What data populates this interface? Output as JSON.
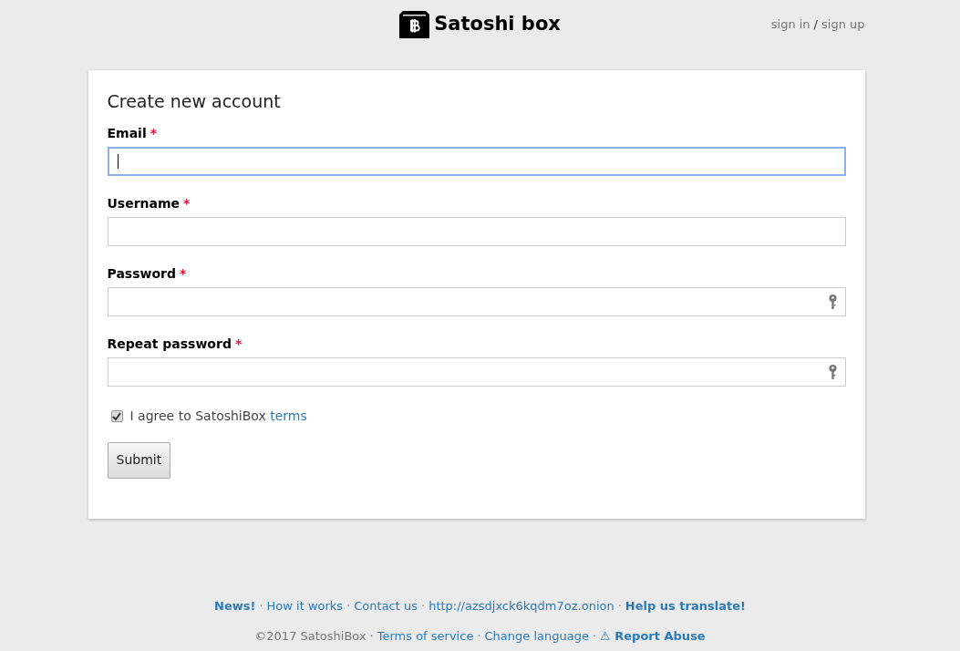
{
  "header": {
    "brand": "Satoshi box",
    "auth_links": [
      {
        "kind": "link",
        "text": "sign in"
      },
      {
        "kind": "text",
        "text": "/"
      },
      {
        "kind": "link",
        "text": "sign up"
      }
    ]
  },
  "form": {
    "title": "Create new account",
    "fields": [
      {
        "label": "Email",
        "required_mark": "*",
        "kind": "email",
        "focused": true
      },
      {
        "label": "Username",
        "required_mark": "*",
        "kind": "text",
        "focused": false
      },
      {
        "label": "Password",
        "required_mark": "*",
        "kind": "password",
        "focused": false
      },
      {
        "label": "Repeat password",
        "required_mark": "*",
        "kind": "password",
        "focused": false
      }
    ],
    "agree": {
      "checked": true,
      "text": "I agree to SatoshiBox",
      "link": "terms"
    },
    "submit": "Submit"
  },
  "footer": [
    [
      {
        "kind": "link",
        "bold": true,
        "text": "News!"
      },
      {
        "kind": "separator",
        "text": "·"
      },
      {
        "kind": "link",
        "bold": false,
        "text": "How it works"
      },
      {
        "kind": "separator",
        "text": "·"
      },
      {
        "kind": "link",
        "bold": false,
        "text": "Contact us"
      },
      {
        "kind": "separator",
        "text": "·"
      },
      {
        "kind": "link",
        "bold": false,
        "text": "http://azsdjxck6kqdm7oz.onion"
      },
      {
        "kind": "separator",
        "text": "·"
      },
      {
        "kind": "link",
        "bold": true,
        "text": "Help us translate!"
      }
    ],
    [
      {
        "kind": "text",
        "bold": false,
        "text": "©2017 SatoshiBox"
      },
      {
        "kind": "separator",
        "text": "·"
      },
      {
        "kind": "link",
        "bold": false,
        "text": "Terms of service"
      },
      {
        "kind": "separator",
        "text": "·"
      },
      {
        "kind": "link",
        "bold": false,
        "text": "Change language"
      },
      {
        "kind": "separator",
        "text": "·"
      },
      {
        "kind": "link",
        "bold": true,
        "text": "⚠ Report Abuse"
      }
    ]
  ]
}
